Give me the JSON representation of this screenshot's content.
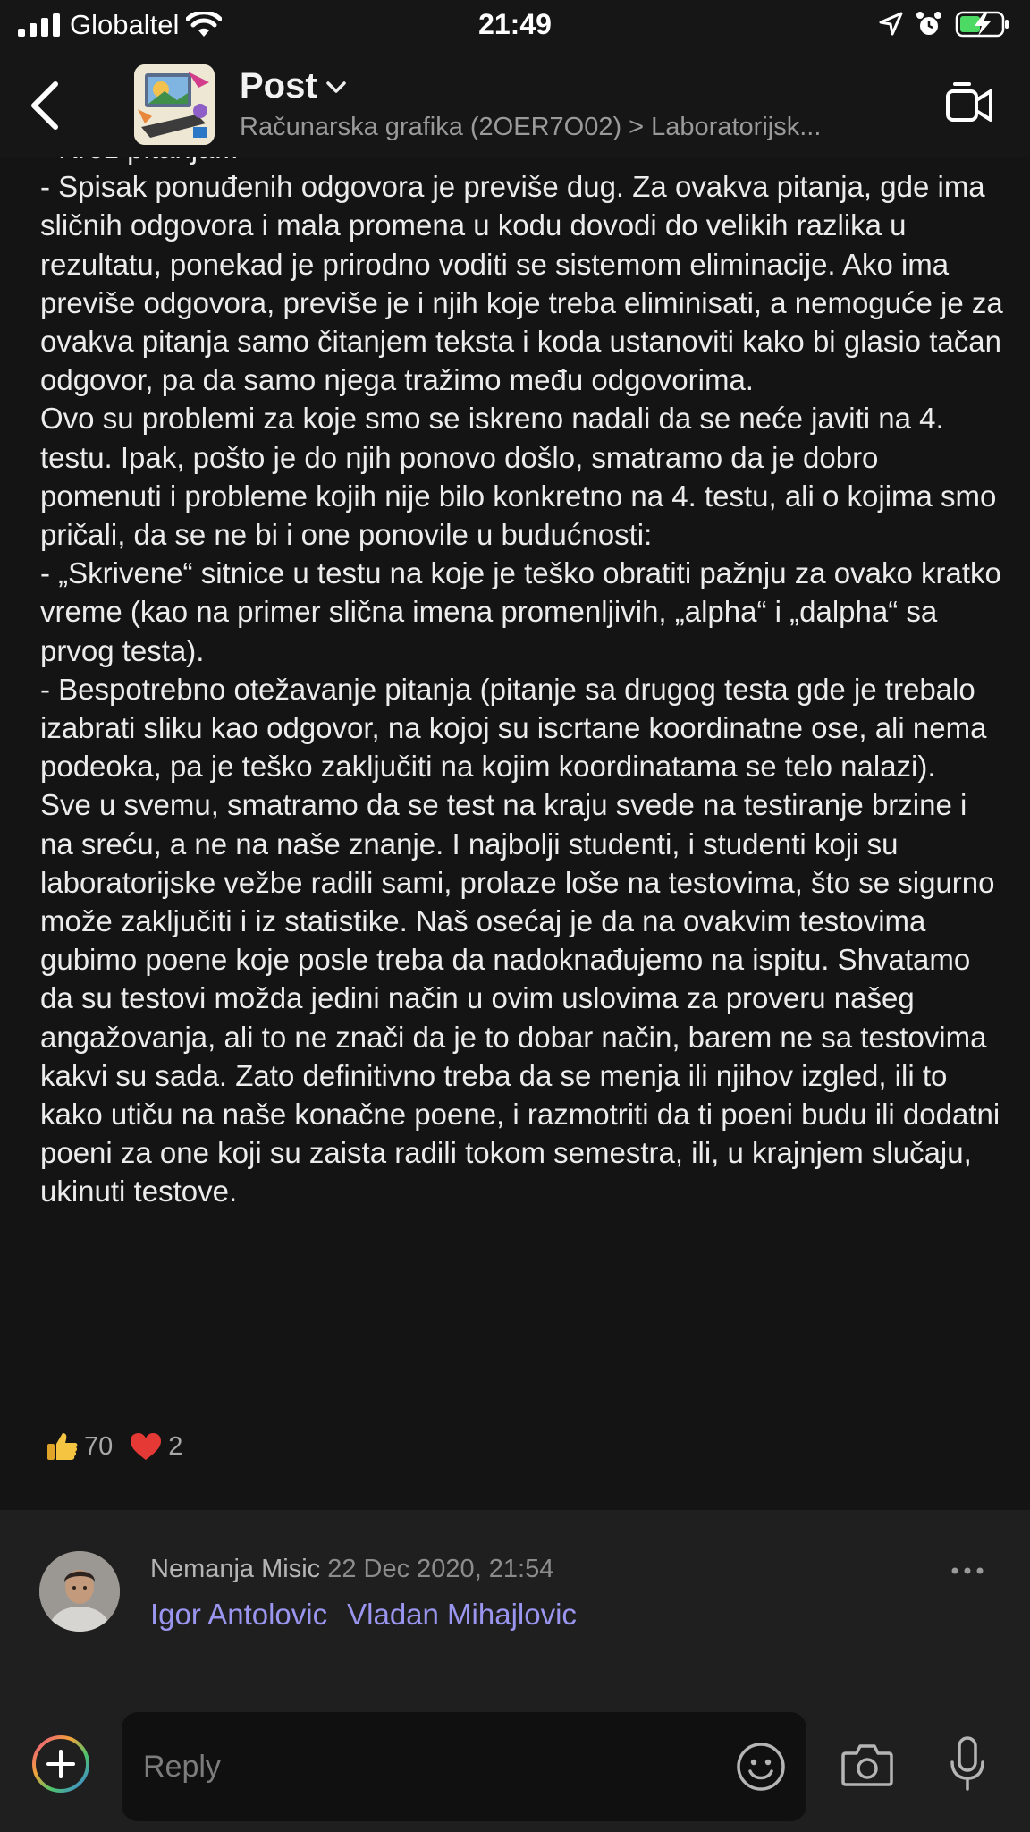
{
  "status_bar": {
    "carrier": "Globaltel",
    "time": "21:49",
    "icons": [
      "signal-icon",
      "wifi-icon",
      "location-arrow-icon",
      "alarm-icon",
      "battery-charging-icon"
    ]
  },
  "header": {
    "title": "Post",
    "subtitle": "Računarska grafika (2OER7O02) > Laboratorijsk...",
    "icons": [
      "back-chevron-icon",
      "chevron-down-icon",
      "video-call-icon"
    ]
  },
  "post": {
    "body": "- Kroz pitanja...\n- Spisak ponuđenih odgovora je previše dug. Za ovakva pitanja, gde ima sličnih odgovora i mala promena u kodu dovodi do velikih razlika u rezultatu, ponekad je prirodno voditi se sistemom eliminacije. Ako ima previše odgovora, previše je i njih koje treba eliminisati, a nemoguće je za ovakva pitanja samo čitanjem teksta i koda ustanoviti kako bi glasio tačan odgovor, pa da samo njega tražimo među odgovorima.\nOvo su problemi za koje smo se iskreno nadali da se neće javiti na 4. testu. Ipak, pošto je do njih ponovo došlo, smatramo da je dobro pomenuti i probleme kojih nije bilo konkretno na 4. testu, ali o kojima smo pričali, da se ne bi i one ponovile u budućnosti:\n- „Skrivene“ sitnice u testu na koje je teško obratiti pažnju za ovako kratko vreme (kao na primer slična imena promenljivih, „alpha“ i „dalpha“ sa prvog testa).\n- Bespotrebno otežavanje pitanja (pitanje sa drugog testa gde je trebalo izabrati sliku kao odgovor, na kojoj su iscrtane koordinatne ose, ali nema podeoka, pa je teško zaključiti na kojim koordinatama se telo nalazi).\nSve u svemu, smatramo da se test na kraju svede na testiranje brzine i na sreću, a ne na naše znanje. I najbolji studenti, i studenti koji su laboratorijske vežbe radili sami, prolaze loše na testovima, što se sigurno može zaključiti i iz statistike. Naš osećaj je da na ovakvim testovima gubimo poene koje posle treba da nadoknađujemo na ispitu. Shvatamo da su testovi možda jedini način u ovim uslovima za proveru našeg angažovanja, ali to ne znači da je to dobar način, barem ne sa testovima kakvi su sada. Zato definitivno treba da se menja ili njihov izgled, ili to kako utiču na naše konačne poene, i razmotriti da ti poeni budu ili dodatni poeni za one koji su zaista radili tokom semestra, ili, u krajnjem slučaju, ukinuti testove.",
    "reactions": [
      {
        "icon": "thumbs-up-icon",
        "count": "70"
      },
      {
        "icon": "heart-icon",
        "count": "2"
      }
    ]
  },
  "comment": {
    "author": "Nemanja Misic",
    "date": "22 Dec 2020, 21:54",
    "mentions": [
      "Igor Antolovic",
      "Vladan Mihajlovic"
    ]
  },
  "composer": {
    "placeholder": "Reply",
    "icons": [
      "add-icon",
      "emoji-icon",
      "camera-icon",
      "microphone-icon"
    ]
  },
  "colors": {
    "background": "#141414",
    "panel": "#1f1f1f",
    "mention": "#9a95ee",
    "heart": "#e53935",
    "thumbs": "#f5c542"
  }
}
